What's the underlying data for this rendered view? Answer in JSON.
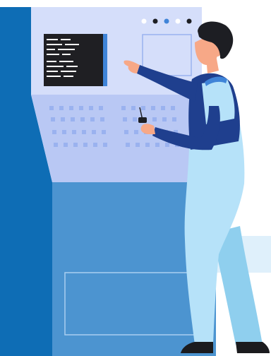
{
  "illustration": {
    "subject": "engineer-operating-control-panel",
    "colors": {
      "panel_side": "#0e6db5",
      "panel_top": "#d5defa",
      "panel_slope": "#b9c8f4",
      "panel_lower": "#4c94d0",
      "screen_dark": "#1f1f23",
      "screen_accent": "#3f84d8",
      "overalls": "#b6e2f9",
      "shirt": "#1f3f8e",
      "skin": "#f7a887",
      "hair": "#1d1e23",
      "boots": "#1b1b1e",
      "indicator_blue": "#3f84d8",
      "indicator_dark": "#1d1e23"
    },
    "indicator_lights": [
      "white",
      "dark",
      "blue",
      "white",
      "dark"
    ],
    "icons": [
      "terminal-screen-icon",
      "remote-control-icon"
    ]
  }
}
